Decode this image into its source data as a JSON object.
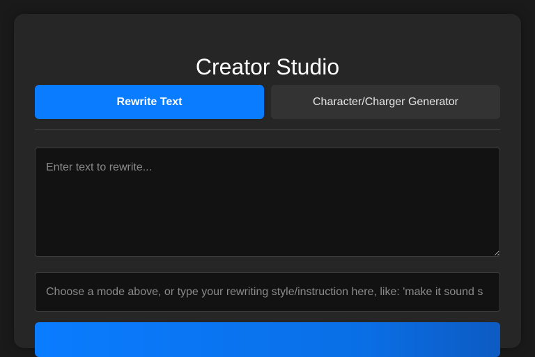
{
  "app": {
    "title": "Creator Studio"
  },
  "tabs": [
    {
      "label": "Rewrite Text",
      "active": true
    },
    {
      "label": "Character/Charger Generator",
      "active": false
    }
  ],
  "rewrite": {
    "text_placeholder": "Enter text to rewrite...",
    "text_value": "",
    "instruction_placeholder": "Choose a mode above, or type your rewriting style/instruction here, like: 'make it sound s",
    "instruction_value": ""
  },
  "colors": {
    "accent": "#0a7cff",
    "card_bg": "#262626",
    "page_bg": "#1a1a1a",
    "input_bg": "#121212"
  }
}
